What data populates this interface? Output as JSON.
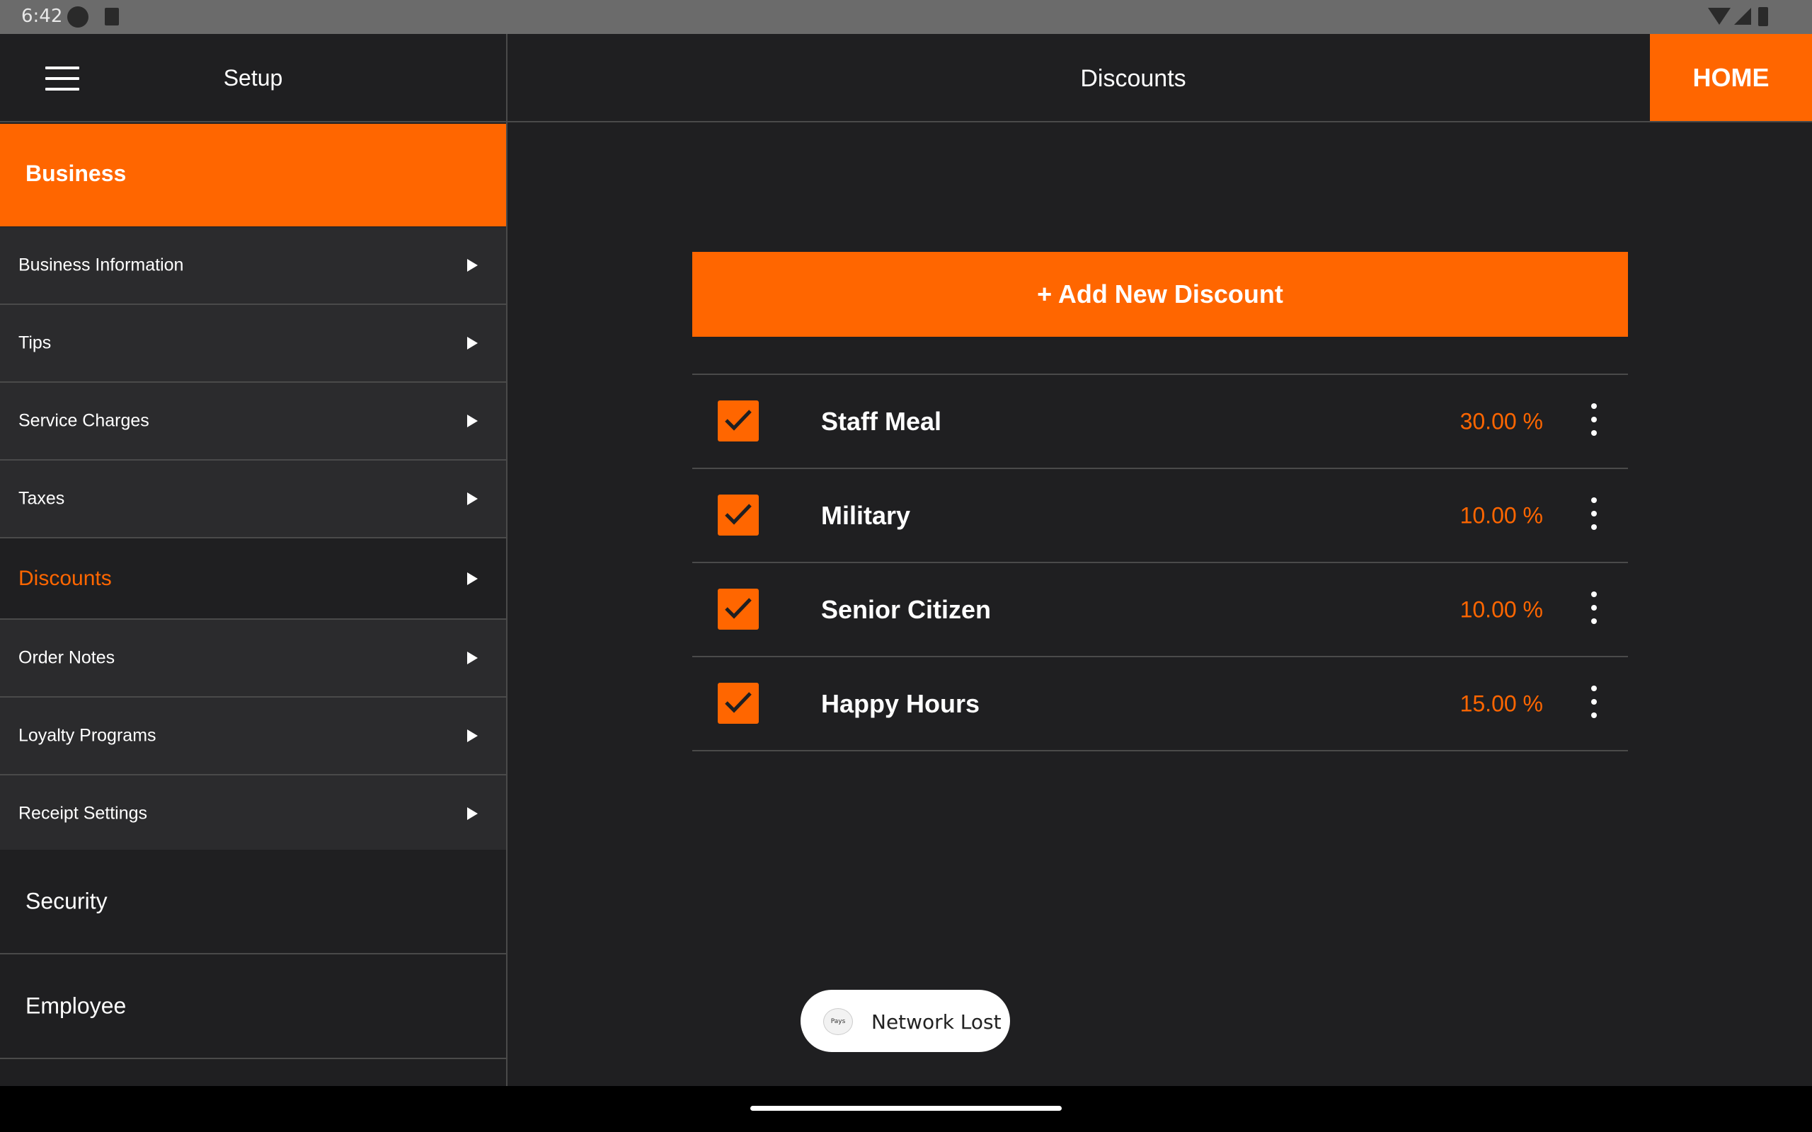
{
  "status_bar": {
    "time": "6:42"
  },
  "sidebar": {
    "title": "Setup",
    "section": "Business",
    "items": [
      {
        "label": "Business Information"
      },
      {
        "label": "Tips"
      },
      {
        "label": "Service Charges"
      },
      {
        "label": "Taxes"
      },
      {
        "label": "Discounts"
      },
      {
        "label": "Order Notes"
      },
      {
        "label": "Loyalty Programs"
      },
      {
        "label": "Receipt Settings"
      }
    ],
    "security": "Security",
    "employee": "Employee"
  },
  "header": {
    "title": "Discounts",
    "home_label": "HOME"
  },
  "add_button_label": "+ Add New Discount",
  "discounts": [
    {
      "name": "Staff Meal",
      "value": "30.00 %",
      "enabled": true
    },
    {
      "name": "Military",
      "value": "10.00 %",
      "enabled": true
    },
    {
      "name": "Senior Citizen",
      "value": "10.00 %",
      "enabled": true
    },
    {
      "name": "Happy Hours",
      "value": "15.00 %",
      "enabled": true
    }
  ],
  "toast": {
    "app_icon_text": "Pays",
    "message": "Network Lost"
  },
  "colors": {
    "accent": "#ff6600",
    "background": "#1f1f21",
    "panel": "#2b2b2d"
  }
}
